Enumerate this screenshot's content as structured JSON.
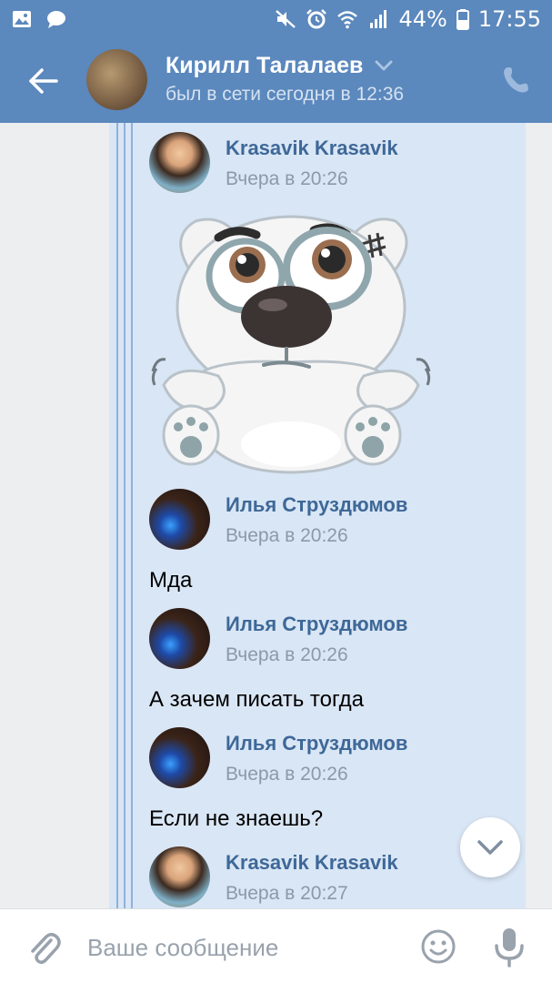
{
  "status_bar": {
    "battery": "44%",
    "time": "17:55",
    "icons": [
      "image-icon",
      "chat-bubble-icon",
      "mute-icon",
      "alarm-icon",
      "wifi-icon",
      "signal-icon",
      "battery-icon"
    ]
  },
  "header": {
    "name": "Кирилл Талалаев",
    "status": "был в сети сегодня в 12:36",
    "icons": [
      "back-arrow-icon",
      "chevron-down-icon",
      "phone-icon"
    ]
  },
  "messages": [
    {
      "sender": "Krasavik Krasavik",
      "time": "Вчера в 20:26",
      "text": "",
      "has_sticker": true
    },
    {
      "sender": "Илья Струздюмов",
      "time": "Вчера в 20:26",
      "text": "Мда"
    },
    {
      "sender": "Илья Струздюмов",
      "time": "Вчера в 20:26",
      "text": "А зачем писать тогда"
    },
    {
      "sender": "Илья Струздюмов",
      "time": "Вчера в 20:26",
      "text": "Если не знаешь?"
    },
    {
      "sender": "Krasavik Krasavik",
      "time": "Вчера в 20:27",
      "text": ""
    }
  ],
  "input_bar": {
    "placeholder": "Ваше сообщение",
    "icons": [
      "paperclip-icon",
      "emoji-icon",
      "microphone-icon"
    ]
  },
  "colors": {
    "header_bg": "#5b88bd",
    "sender_name": "#3e6898",
    "forward_bg": "#d9e6f5",
    "forward_line": "#8fb1d9"
  }
}
